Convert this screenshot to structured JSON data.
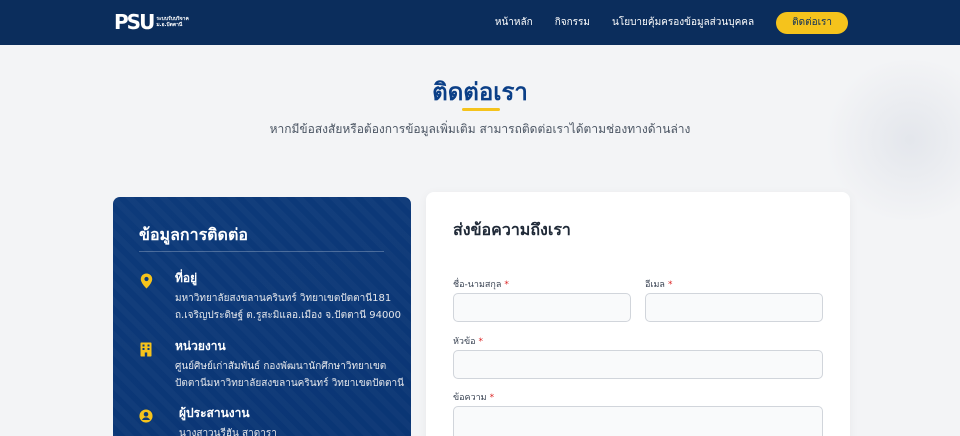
{
  "navbar": {
    "logo_mark": "PSU",
    "logo_lines": [
      "ระบบรับบริจาค",
      "ม.อ.ปัตตานี"
    ],
    "links": [
      "หน้าหลัก",
      "กิจกรรม",
      "นโยบายคุ้มครองข้อมูลส่วนบุคคล"
    ],
    "cta": "ติดต่อเรา",
    "bg_color": "#0b2d5c",
    "cta_color": "#f5c31c"
  },
  "header": {
    "title": "ติดต่อเรา",
    "subtitle": "หากมีข้อสงสัยหรือต้องการข้อมูลเพิ่มเติม สามารถติดต่อเราได้ตามช่องทางด้านล่าง"
  },
  "info": {
    "title": "ข้อมูลการติดต่อ",
    "items": [
      {
        "icon": "map-pin-icon",
        "label": "ที่อยู่",
        "lines": [
          "มหาวิทยาลัยสงขลานครินทร์ วิทยาเขตปัตตานี181",
          "ถ.เจริญประดิษฐ์ ต.รูสะมิแลอ.เมือง จ.ปัตตานี 94000"
        ]
      },
      {
        "icon": "building-icon",
        "label": "หน่วยงาน",
        "lines": [
          "ศูนย์ศิษย์เก่าสัมพันธ์ กองพัฒนานักศึกษาวิทยาเขต",
          "ปัตตานีมหาวิทยาลัยสงขลานครินทร์ วิทยาเขตปัตตานี"
        ]
      },
      {
        "icon": "user-icon",
        "label": "ผู้ประสานงาน",
        "lines": [
          "นางสาวนูรีฮัน สาดารา"
        ]
      }
    ]
  },
  "form": {
    "title": "ส่งข้อความถึงเรา",
    "required_mark": "*",
    "fields": {
      "name": {
        "label": "ชื่อ-นามสกุล",
        "value": ""
      },
      "email": {
        "label": "อีเมล",
        "value": ""
      },
      "subject": {
        "label": "หัวข้อ",
        "value": ""
      },
      "message": {
        "label": "ข้อความ",
        "value": ""
      }
    }
  }
}
